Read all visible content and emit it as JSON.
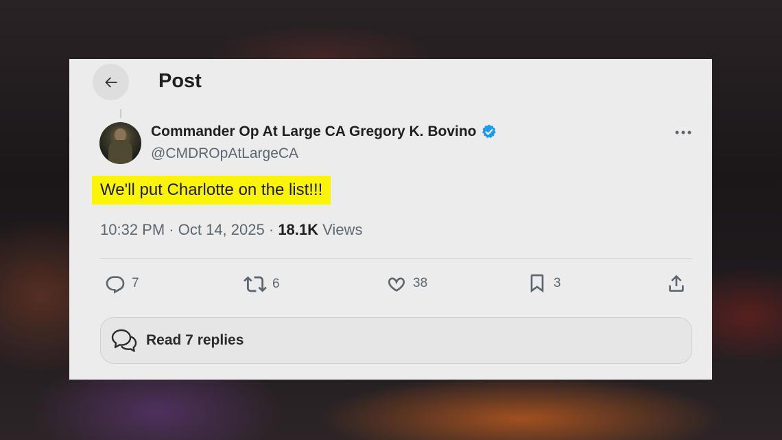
{
  "header": {
    "title": "Post"
  },
  "author": {
    "display_name": "Commander Op At Large CA Gregory K. Bovino",
    "handle": "@CMDROpAtLargeCA",
    "verified": true
  },
  "post": {
    "text": "We'll put Charlotte on the list!!!",
    "time": "10:32 PM",
    "separator": "·",
    "date": "Oct 14, 2025",
    "views_count": "18.1K",
    "views_label": "Views"
  },
  "actions": {
    "replies": "7",
    "reposts": "6",
    "likes": "38",
    "bookmarks": "3"
  },
  "read_replies": {
    "label": "Read 7 replies"
  },
  "colors": {
    "highlight": "#fbf407",
    "verified_badge": "#1d9bf0",
    "muted_text": "#5d6770"
  }
}
